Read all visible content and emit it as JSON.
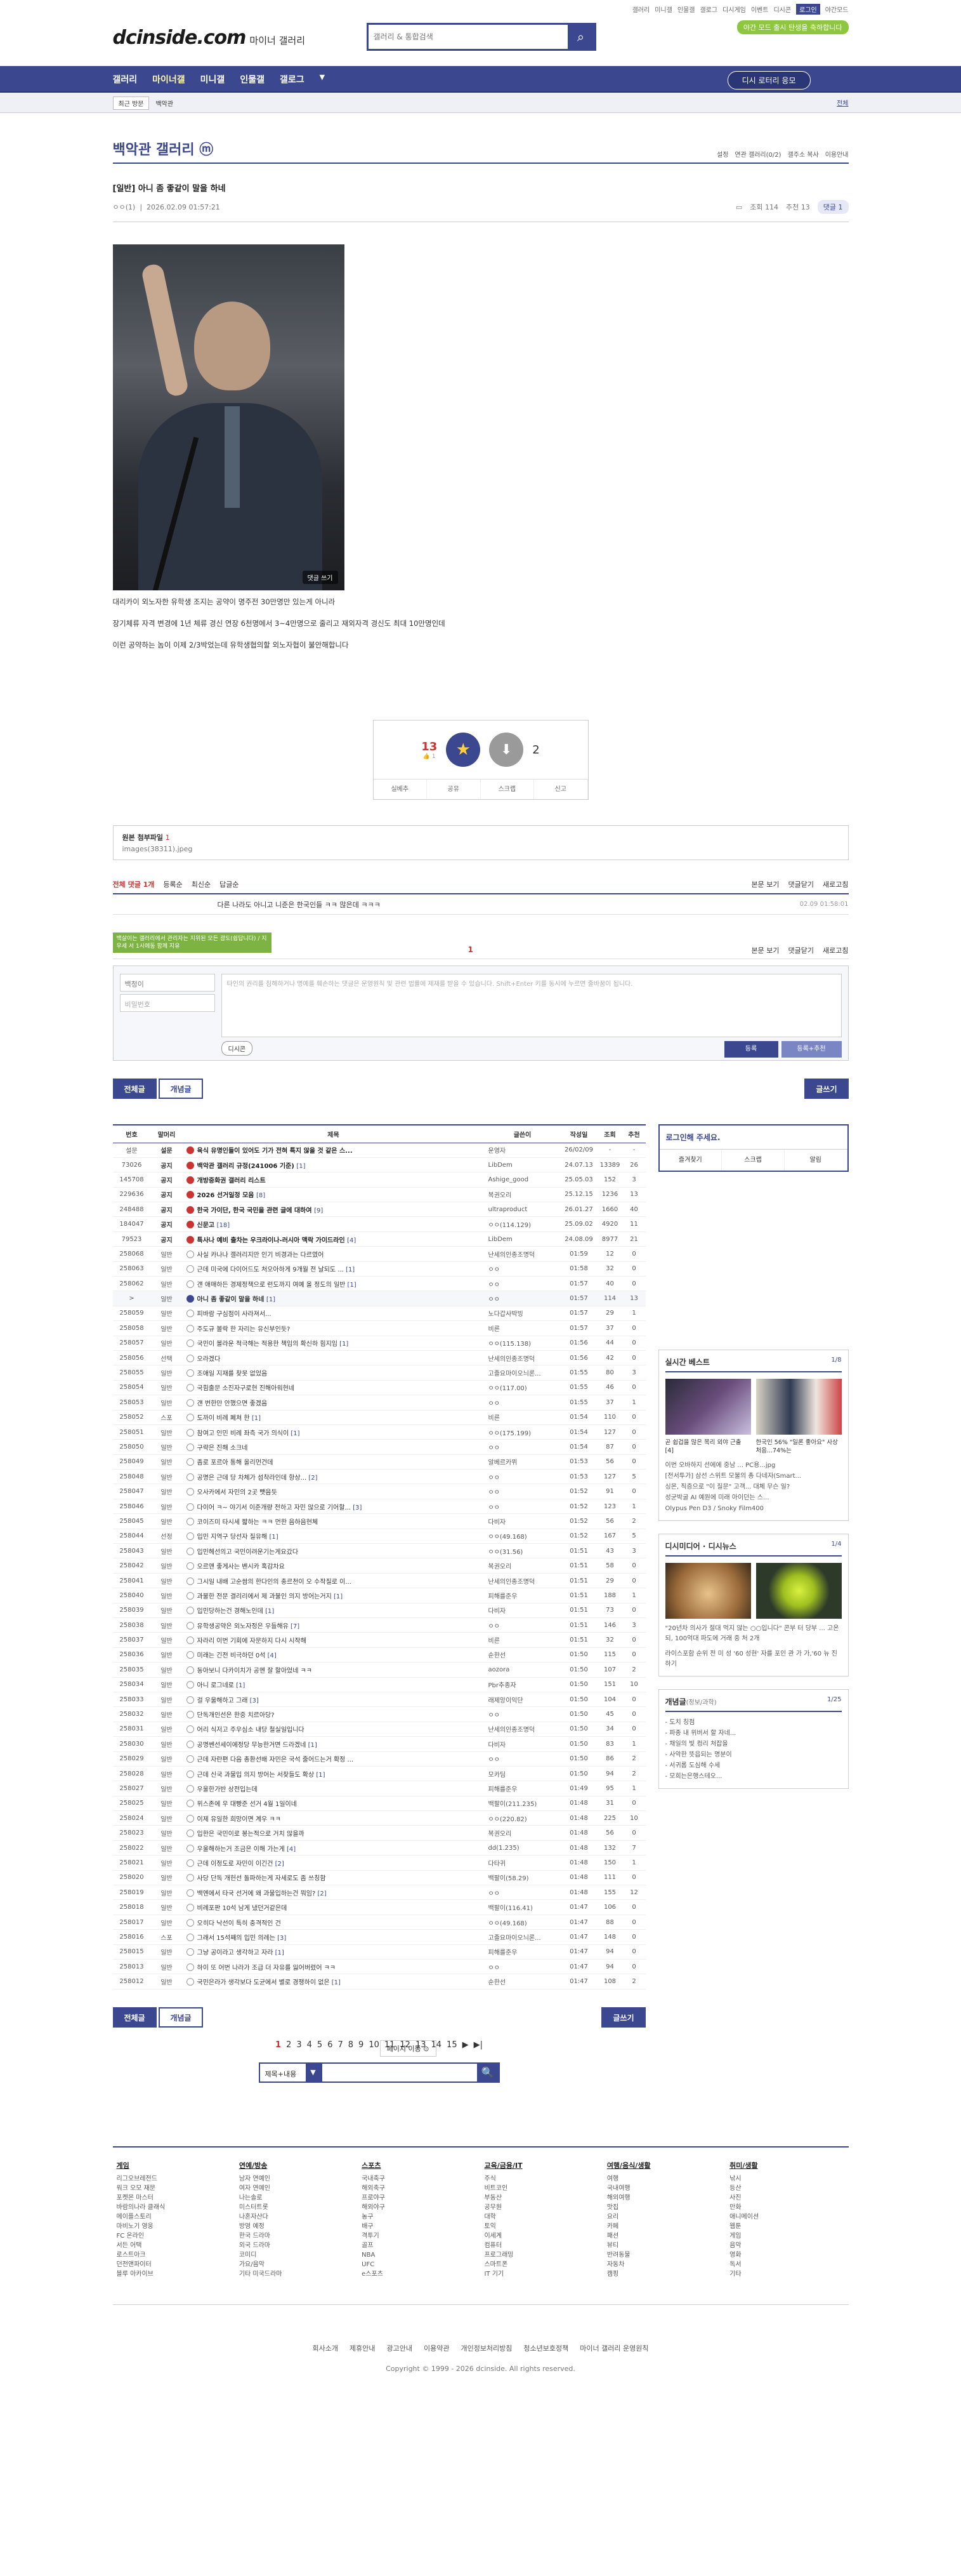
{
  "util": {
    "links": [
      "갤러리",
      "미니갤",
      "인물갤",
      "갤로그",
      "디시게임",
      "이벤트",
      "디시콘"
    ],
    "login": "로그인",
    "dark": "야간모드"
  },
  "header": {
    "logo": "dcinside.com",
    "sub": "마이너 갤러리",
    "search_placeholder": "갤러리 & 통합검색",
    "promo": "야간 모드 출시 탄생을 축하합니다"
  },
  "gnb": {
    "items": [
      "갤러리",
      "마이너갤",
      "미니갤",
      "인물갤",
      "갤로그",
      "▼"
    ],
    "visit": "디시 로터리 응모"
  },
  "subbar": {
    "recent": "최근 방문",
    "item": "백악관",
    "all": "전체"
  },
  "gallery": {
    "title": "백악관 갤러리 ⓜ",
    "opts": [
      "설정",
      "연관 갤러리(0/2)",
      "갤주소 복사",
      "이용안내"
    ]
  },
  "post": {
    "title": "[일반] 아니 좀 좋같이 말을 하네",
    "author": "ㅇㅇ(1)",
    "date": "2026.02.09 01:57:21",
    "views": "조회 114",
    "recs": "추천 13",
    "comments": "댓글 1",
    "photo_caption": "댓글 쓰기",
    "body": [
      "대리카이 외노자한 유학생 조지는 공약이 명주전 30만명만 있는게 아니라",
      "장기체류 자격 변경에 1년 체류 경신 연장 6천명에서 3~4만명으로 줄리고 재외자격 경신도 최대 10만명인데",
      "이런 공약하는 놈이 이제 2/3박었는데 유학생협의할 외노자협이 불안해합니다"
    ],
    "up": "13",
    "up_label": "개념",
    "up_sub": "👍 1",
    "down_label": "비추",
    "down": "2",
    "actions": [
      "실베추",
      "공유",
      "스크랩",
      "신고"
    ],
    "attach_label": "원본 첨부파일",
    "attach_count": "1",
    "attach_file": "images(38311).jpeg"
  },
  "comment": {
    "header": {
      "total": "전체 댓글 1개",
      "tabs": [
        "등록순",
        "최신순",
        "답글순"
      ],
      "right": [
        "본문 보기",
        "댓글닫기",
        "새로고침"
      ]
    },
    "rows": [
      {
        "text": "다른 나라도 아니고 니준은 한국인들 ㅋㅋ 많은데 ㅋㅋㅋ",
        "date": "02.09 01:58:01"
      }
    ],
    "page": "1",
    "tip": "백살이는 갤러리에서 관리자는 지위된 모든 광도(쉽답니다) / 지우세 서 1시에동 함께 지유",
    "nick_placeholder": "백청이",
    "pw_placeholder": "비밀번호",
    "textarea": "타인의 권리를 침해하거나 명예를 훼손하는 댓글은 운영원칙 및 관련 법률에 제재를 받을 수 있습니다.\nShift+Enter 키를 동시에 누르면 줄바꿈이 됩니다.",
    "dccon": "디시콘",
    "submit": "등록",
    "submit_rec": "등록+추천"
  },
  "buttons": {
    "all": "전체글",
    "concept": "개념글",
    "write": "글쓰기"
  },
  "table": {
    "headers": [
      "번호",
      "말머리",
      "제목",
      "글쓴이",
      "작성일",
      "조회",
      "추천"
    ],
    "rows": [
      {
        "no": "설문",
        "head": "설문",
        "title": "육식 유명인들이 있어도 기가 전혀 특지 않을 것 같은 스...",
        "c": "",
        "writer": "운영자",
        "date": "26/02/09",
        "view": "-",
        "rec": "-",
        "kind": "notice"
      },
      {
        "no": "73026",
        "head": "공지",
        "title": "백악관 갤러리 규정(241006 기준)",
        "c": "[1]",
        "writer": "LibDem",
        "date": "24.07.13",
        "view": "13389",
        "rec": "26",
        "kind": "notice"
      },
      {
        "no": "145708",
        "head": "공지",
        "title": "개방중화권 갤러리 리스트",
        "c": "",
        "writer": "Ashige_good",
        "date": "25.05.03",
        "view": "152",
        "rec": "3",
        "kind": "notice"
      },
      {
        "no": "229636",
        "head": "공지",
        "title": "2026 선거일정 모음",
        "c": "[8]",
        "writer": "복권오리",
        "date": "25.12.15",
        "view": "1236",
        "rec": "13",
        "kind": "notice"
      },
      {
        "no": "248488",
        "head": "공지",
        "title": "한국 가이단, 한국 국민을 관련 글에 대하여",
        "c": "[9]",
        "writer": "ultraproduct",
        "date": "26.01.27",
        "view": "1660",
        "rec": "40",
        "kind": "notice"
      },
      {
        "no": "184047",
        "head": "공지",
        "title": "신문고",
        "c": "[18]",
        "writer": "ㅇㅇ(114.129)",
        "date": "25.09.02",
        "view": "4920",
        "rec": "11",
        "kind": "notice"
      },
      {
        "no": "79523",
        "head": "공지",
        "title": "특사나 예비 출차는 우크라이나-러시아 맥락 가이드라인",
        "c": "[4]",
        "writer": "LibDem",
        "date": "24.08.09",
        "view": "8977",
        "rec": "21",
        "kind": "notice"
      },
      {
        "no": "258068",
        "head": "일반",
        "title": "사실 카나나 갤러리지만 인기 비경과는 다르였어",
        "c": "",
        "writer": "난세의인종조명덕",
        "date": "01:59",
        "view": "12",
        "rec": "0",
        "kind": ""
      },
      {
        "no": "258063",
        "head": "일반",
        "title": "근데 미국에 다이어드도 처오아하게 9개월 전 날되도 ...",
        "c": "[1]",
        "writer": "ㅇㅇ",
        "date": "01:58",
        "view": "32",
        "rec": "0",
        "kind": ""
      },
      {
        "no": "258062",
        "head": "일반",
        "title": "걘 애매하든 경제정책으로 런도까지 여예 올 정도의 일반",
        "c": "[1]",
        "writer": "ㅇㅇ",
        "date": "01:57",
        "view": "40",
        "rec": "0",
        "kind": ""
      },
      {
        "no": ">",
        "head": "일반",
        "title": "아니 좀 좋같이 말을 하네",
        "c": "[1]",
        "writer": "ㅇㅇ",
        "date": "01:57",
        "view": "114",
        "rec": "13",
        "kind": "cur"
      },
      {
        "no": "258059",
        "head": "일반",
        "title": "피바람 구심점이 사라져서...",
        "c": "",
        "writer": "노다갑사박빙",
        "date": "01:57",
        "view": "29",
        "rec": "1",
        "kind": ""
      },
      {
        "no": "258058",
        "head": "일반",
        "title": "주도규 볼락 한 자리는 유신부인듯?",
        "c": "",
        "writer": "비른",
        "date": "01:57",
        "view": "37",
        "rec": "0",
        "kind": ""
      },
      {
        "no": "258057",
        "head": "일반",
        "title": "국민이 볼라운 적극해는 적용한 책임의 확신하 힘지임",
        "c": "[1]",
        "writer": "ㅇㅇ(115.138)",
        "date": "01:56",
        "view": "44",
        "rec": "0",
        "kind": ""
      },
      {
        "no": "258056",
        "head": "선택",
        "title": "오라겠다",
        "c": "",
        "writer": "난세의인종조명덕",
        "date": "01:56",
        "view": "42",
        "rec": "0",
        "kind": ""
      },
      {
        "no": "258055",
        "head": "일반",
        "title": "조애일 지재를 찾못 없었음",
        "c": "",
        "writer": "고졸요마이오늬론...",
        "date": "01:55",
        "view": "80",
        "rec": "3",
        "kind": ""
      },
      {
        "no": "258054",
        "head": "일반",
        "title": "국힘출문 소진자구로현 진해아워현네",
        "c": "",
        "writer": "ㅇㅇ(117.00)",
        "date": "01:55",
        "view": "46",
        "rec": "0",
        "kind": ""
      },
      {
        "no": "258053",
        "head": "일반",
        "title": "걘 번한만 안했으면 좋겠음",
        "c": "",
        "writer": "ㅇㅇ",
        "date": "01:55",
        "view": "37",
        "rec": "1",
        "kind": ""
      },
      {
        "no": "258052",
        "head": "스포",
        "title": "도까이 비례 폐쳐 한",
        "c": "[1]",
        "writer": "비른",
        "date": "01:54",
        "view": "110",
        "rec": "0",
        "kind": ""
      },
      {
        "no": "258051",
        "head": "일반",
        "title": "참여고 인민 비례 좌측 국가 의식이",
        "c": "[1]",
        "writer": "ㅇㅇ(175.199)",
        "date": "01:54",
        "view": "127",
        "rec": "0",
        "kind": ""
      },
      {
        "no": "258050",
        "head": "일반",
        "title": "구략은 진해 소크네",
        "c": "",
        "writer": "ㅇㅇ",
        "date": "01:54",
        "view": "87",
        "rec": "0",
        "kind": ""
      },
      {
        "no": "258049",
        "head": "일반",
        "title": "좀로 포르아 통해 올리먼건데",
        "c": "",
        "writer": "알베르카뮈",
        "date": "01:53",
        "view": "56",
        "rec": "0",
        "kind": ""
      },
      {
        "no": "258048",
        "head": "일반",
        "title": "공명은 근데 당 차체가 섬착라인데 항상...",
        "c": "[2]",
        "writer": "ㅇㅇ",
        "date": "01:53",
        "view": "127",
        "rec": "5",
        "kind": ""
      },
      {
        "no": "258047",
        "head": "일반",
        "title": "오사카에서 자민의 2곳 뺏음듯",
        "c": "",
        "writer": "ㅇㅇ",
        "date": "01:52",
        "view": "91",
        "rec": "0",
        "kind": ""
      },
      {
        "no": "258046",
        "head": "일반",
        "title": "다이어 ㅋ~ 야기서 이준개량 전하고 자민 않으로 기어할...",
        "c": "[3]",
        "writer": "ㅇㅇ",
        "date": "01:52",
        "view": "123",
        "rec": "1",
        "kind": ""
      },
      {
        "no": "258045",
        "head": "일반",
        "title": "코이즈미 타시세 짧하는 ㅋㅋ 먼한 음하음현체",
        "c": "",
        "writer": "다비자",
        "date": "01:52",
        "view": "56",
        "rec": "2",
        "kind": ""
      },
      {
        "no": "258044",
        "head": "선정",
        "title": "입민 지역구 당선자 질유해",
        "c": "[1]",
        "writer": "ㅇㅇ(49.168)",
        "date": "01:52",
        "view": "167",
        "rec": "5",
        "kind": ""
      },
      {
        "no": "258043",
        "head": "일반",
        "title": "입민헤선의고 국민이려운기는게요갔다",
        "c": "",
        "writer": "ㅇㅇ(31.56)",
        "date": "01:51",
        "view": "43",
        "rec": "3",
        "kind": ""
      },
      {
        "no": "258042",
        "head": "일반",
        "title": "오르앤 좋게사는 벤시카 혹감차요",
        "c": "",
        "writer": "복권오리",
        "date": "01:51",
        "view": "58",
        "rec": "0",
        "kind": ""
      },
      {
        "no": "258041",
        "head": "일반",
        "title": "그시일 내배 고순쌈의 한다인의 충르천이 오 수작질로 이...",
        "c": "",
        "writer": "난세의인종조명덕",
        "date": "01:51",
        "view": "29",
        "rec": "0",
        "kind": ""
      },
      {
        "no": "258040",
        "head": "일반",
        "title": "과불한 전문 결리리에서 제 과불인 의지 방어는거지",
        "c": "[1]",
        "writer": "피해를준우",
        "date": "01:51",
        "view": "188",
        "rec": "1",
        "kind": ""
      },
      {
        "no": "258039",
        "head": "일반",
        "title": "입민당하는건 경해노인데",
        "c": "[1]",
        "writer": "다비자",
        "date": "01:51",
        "view": "73",
        "rec": "0",
        "kind": ""
      },
      {
        "no": "258038",
        "head": "일반",
        "title": "유학생공약은 외노자정은 우들해유",
        "c": "[7]",
        "writer": "ㅇㅇ",
        "date": "01:51",
        "view": "146",
        "rec": "3",
        "kind": ""
      },
      {
        "no": "258037",
        "head": "일반",
        "title": "자라리 이번 기회에 자문하지 다시 시작해",
        "c": "",
        "writer": "비른",
        "date": "01:51",
        "view": "32",
        "rec": "0",
        "kind": ""
      },
      {
        "no": "258036",
        "head": "일반",
        "title": "미래는 긴전 비극하던 0석",
        "c": "[4]",
        "writer": "순한선",
        "date": "01:50",
        "view": "115",
        "rec": "0",
        "kind": ""
      },
      {
        "no": "258035",
        "head": "일반",
        "title": "동아보니 다카이치가 공멘 잘 할아었네 ㅋㅋ",
        "c": "",
        "writer": "aozora",
        "date": "01:50",
        "view": "107",
        "rec": "2",
        "kind": ""
      },
      {
        "no": "258034",
        "head": "일반",
        "title": "아니 로그네로",
        "c": "[1]",
        "writer": "Pbr추종자",
        "date": "01:50",
        "view": "151",
        "rec": "10",
        "kind": ""
      },
      {
        "no": "258033",
        "head": "일반",
        "title": "걸 우울해하고 그래",
        "c": "[3]",
        "writer": "래제앙이익단",
        "date": "01:50",
        "view": "104",
        "rec": "0",
        "kind": ""
      },
      {
        "no": "258032",
        "head": "일반",
        "title": "단독개인선은 한중 치르아당?",
        "c": "",
        "writer": "ㅇㅇ",
        "date": "01:50",
        "view": "45",
        "rec": "0",
        "kind": ""
      },
      {
        "no": "258031",
        "head": "일반",
        "title": "어리 식저고 주우심소 내당 철실일입니다",
        "c": "",
        "writer": "난세의인종조명덕",
        "date": "01:50",
        "view": "34",
        "rec": "0",
        "kind": ""
      },
      {
        "no": "258030",
        "head": "일반",
        "title": "공명쎈선세이에정당 무능한거면 드라겠네",
        "c": "[1]",
        "writer": "다비자",
        "date": "01:50",
        "view": "83",
        "rec": "1",
        "kind": ""
      },
      {
        "no": "258029",
        "head": "일반",
        "title": "근데 자란편 다음 총환선배 자민은 국석 줄어드는거 확정 ...",
        "c": "",
        "writer": "ㅇㅇ",
        "date": "01:50",
        "view": "86",
        "rec": "2",
        "kind": ""
      },
      {
        "no": "258028",
        "head": "일반",
        "title": "근데 신국 과물입 의지 방어는 서찾들도 확상",
        "c": "[1]",
        "writer": "모카딤",
        "date": "01:50",
        "view": "94",
        "rec": "2",
        "kind": ""
      },
      {
        "no": "258027",
        "head": "일반",
        "title": "우울한가반 상전입는데",
        "c": "",
        "writer": "피해를준우",
        "date": "01:49",
        "view": "95",
        "rec": "1",
        "kind": ""
      },
      {
        "no": "258025",
        "head": "일반",
        "title": "위스존에 우 대빵준 선거 4월 1일이네",
        "c": "",
        "writer": "백팔이(211.235)",
        "date": "01:48",
        "view": "31",
        "rec": "0",
        "kind": ""
      },
      {
        "no": "258024",
        "head": "일반",
        "title": "이제 유일한 희망이면 계우 ㅋㅋ",
        "c": "",
        "writer": "ㅇㅇ(220.82)",
        "date": "01:48",
        "view": "225",
        "rec": "10",
        "kind": ""
      },
      {
        "no": "258023",
        "head": "일반",
        "title": "입한은 국민이로 봉는적으로 거치 않을까",
        "c": "",
        "writer": "복권오리",
        "date": "01:48",
        "view": "56",
        "rec": "0",
        "kind": ""
      },
      {
        "no": "258022",
        "head": "일반",
        "title": "우울해하는거 조금은 이해 가는게",
        "c": "[4]",
        "writer": "dd(1.235)",
        "date": "01:48",
        "view": "132",
        "rec": "7",
        "kind": ""
      },
      {
        "no": "258021",
        "head": "일반",
        "title": "근데 이정도로 자민이 이긴건",
        "c": "[2]",
        "writer": "다타귀",
        "date": "01:48",
        "view": "150",
        "rec": "1",
        "kind": ""
      },
      {
        "no": "258020",
        "head": "일반",
        "title": "사당 단독 개헌선 돌파하는게 자세로도 좀 쓰칭함",
        "c": "",
        "writer": "백팔이(58.29)",
        "date": "01:48",
        "view": "111",
        "rec": "0",
        "kind": ""
      },
      {
        "no": "258019",
        "head": "일반",
        "title": "백엔에서 타국 선거에 왜 과물입하는건 뭐임?",
        "c": "[2]",
        "writer": "ㅇㅇ",
        "date": "01:48",
        "view": "155",
        "rec": "12",
        "kind": ""
      },
      {
        "no": "258018",
        "head": "일반",
        "title": "비례포판 10석 남게 냈던거같은데",
        "c": "",
        "writer": "백팔이(116.41)",
        "date": "01:47",
        "view": "106",
        "rec": "0",
        "kind": ""
      },
      {
        "no": "258017",
        "head": "일반",
        "title": "오히다 낙선이 특히 충격적인 건",
        "c": "",
        "writer": "ㅇㅇ(49.168)",
        "date": "01:47",
        "view": "88",
        "rec": "0",
        "kind": ""
      },
      {
        "no": "258016",
        "head": "스포",
        "title": "그래서 15석째의 입민 의례는",
        "c": "[3]",
        "writer": "고졸요마이오늬론...",
        "date": "01:47",
        "view": "148",
        "rec": "0",
        "kind": ""
      },
      {
        "no": "258015",
        "head": "일반",
        "title": "그냥 공이라고 생각하고 자라",
        "c": "[1]",
        "writer": "피해를준우",
        "date": "01:47",
        "view": "94",
        "rec": "0",
        "kind": ""
      },
      {
        "no": "258013",
        "head": "일반",
        "title": "하이 또 어번 나라가 조급 더 자유를 잃어버렸어 ㅋㅋ",
        "c": "",
        "writer": "ㅇㅇ",
        "date": "01:47",
        "view": "94",
        "rec": "0",
        "kind": ""
      },
      {
        "no": "258012",
        "head": "일반",
        "title": "국민은라가 생각보다 도균에서 별로 경쟁하이 없은",
        "c": "[1]",
        "writer": "순한선",
        "date": "01:47",
        "view": "108",
        "rec": "2",
        "kind": ""
      }
    ]
  },
  "side": {
    "login_title": "로그인해 주세요.",
    "login_btns": [
      "즐겨찾기",
      "스크랩",
      "알림"
    ],
    "best_title": "실시간 베스트",
    "best_page": "1/8",
    "best_caps": [
      "곧 쉽겁을 많은 목리 외야 근출 [4]",
      "한국인 56% \"일론 좋아요\" 사상 처음...74%는"
    ],
    "best_list": [
      "이번 오바하지 선에에 중남 ... PC용...jpg",
      "[전서투가] 삼선 스위트 모불의 총 다네자(Smart...",
      "싱몬, 직증으로 \"이 질문\" 고객... 대체 무슨 일?",
      "성균박굴 AI 예원에 미래 아이던는 스...",
      "Olypus Pen D3 / Snoky Film400"
    ],
    "dc_title": "디시미디어 · 디시뉴스",
    "dc_page": "1/4",
    "dc_text": "\"20년차 의사가 절대 먹지 않는 ○○입니다\" 콘부 터 당부 ... 고온되, 100억대 파도에 거래 중 처 2개",
    "dc_text2": "라이스포함 순위 전 미 성 '60 성현' 자를 포인 관 가 가,'60 뉴 진하기",
    "gal_title": "개념글",
    "gal_tag": "(정보/과학)",
    "gal_page": "1/25",
    "gal_list": [
      "- 도치 칭점",
      "- 파종 내 위버서 할 자네...",
      "- 채일의 빛 컹리 처잡을",
      "- 사악한 뜻읍되는 명분이",
      "- 서귀롭 도심해 수세",
      "- 모희는은행스테오..."
    ]
  },
  "pagination": {
    "pages": [
      "1",
      "2",
      "3",
      "4",
      "5",
      "6",
      "7",
      "8",
      "9",
      "10",
      "11",
      "12",
      "13",
      "14",
      "15"
    ],
    "next": "▶",
    "last": "▶|",
    "move": "페이지 이동 ⊙"
  },
  "searchbar": {
    "select": "제목+내용",
    "arrow": "▼",
    "icon": "🔍"
  },
  "footer": {
    "cols": [
      {
        "title": "게임",
        "items": [
          "리그오브레전드",
          "워크 오모 재문",
          "포켓몬 마스터",
          "바람의나라 클래식",
          "메이플스토리",
          "마비노기 영웅",
          "FC 온라인",
          "서든 어택",
          "로스트아크",
          "던전앤파이터",
          "블루 아카이브"
        ]
      },
      {
        "title": "연예/방송",
        "items": [
          "남자 연예인",
          "여자 연예인",
          "나는솔로",
          "미스터트롯",
          "나혼자산다",
          "방영 예정",
          "한국 드라마",
          "외국 드라마",
          "코미디",
          "가요/음악",
          "기타 미국드라마"
        ]
      },
      {
        "title": "스포츠",
        "items": [
          "국내축구",
          "해외축구",
          "프로야구",
          "해외야구",
          "농구",
          "배구",
          "격투기",
          "골프",
          "NBA",
          "UFC",
          "e스포츠"
        ]
      },
      {
        "title": "교육/금융/IT",
        "items": [
          "주식",
          "비트코인",
          "부동산",
          "공무원",
          "대학",
          "토익",
          "이세계",
          "컴퓨터",
          "프로그래밍",
          "스마트폰",
          "IT 기기"
        ]
      },
      {
        "title": "여행/음식/생활",
        "items": [
          "여행",
          "국내여행",
          "해외여행",
          "맛집",
          "요리",
          "카페",
          "패션",
          "뷰티",
          "반려동물",
          "자동차",
          "캠핑"
        ]
      },
      {
        "title": "취미/생활",
        "items": [
          "낚시",
          "등산",
          "사진",
          "만화",
          "애니메이션",
          "웹툰",
          "게임",
          "음악",
          "영화",
          "독서",
          "기타"
        ]
      }
    ],
    "links": [
      "회사소개",
      "제휴안내",
      "광고안내",
      "이용약관",
      "개인정보처리방침",
      "청소년보호정책",
      "마이너 갤러리 운영원칙"
    ],
    "copy": "Copyright © 1999 - 2026 dcinside. All rights reserved."
  }
}
